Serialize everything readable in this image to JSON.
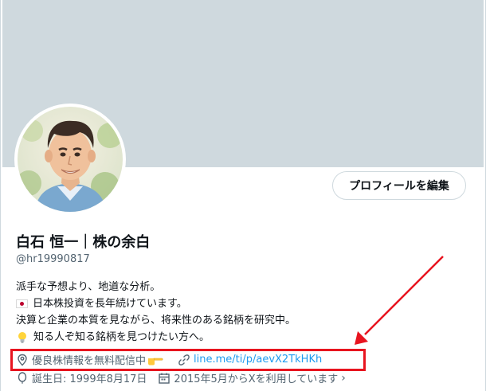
{
  "profile": {
    "name": "白石 恒一｜株の余白",
    "handle": "@hr19990817",
    "edit_button": "プロフィールを編集",
    "bio": [
      "派手な予想より、地道な分析。",
      "日本株投資を長年続けています。",
      "決算と企業の本質を見ながら、将来性のある銘柄を研究中。",
      "知る人ぞ知る銘柄を見つけたい方へ。"
    ],
    "location": "優良株情報を無料配信中",
    "url": "line.me/ti/p/aevX2TkHKh",
    "birthday": "誕生日: 1999年8月17日",
    "joined": "2015年5月からXを利用しています"
  },
  "icons": [
    "location-pin-icon",
    "link-icon",
    "balloon-icon",
    "calendar-icon",
    "chevron-right-icon",
    "japan-flag-icon",
    "lightbulb-icon",
    "pointing-hand-icon"
  ],
  "colors": {
    "banner": "#cfd9de",
    "link": "#1d9bf0",
    "secondary_text": "#536471",
    "annotation_red": "#e8141f"
  }
}
